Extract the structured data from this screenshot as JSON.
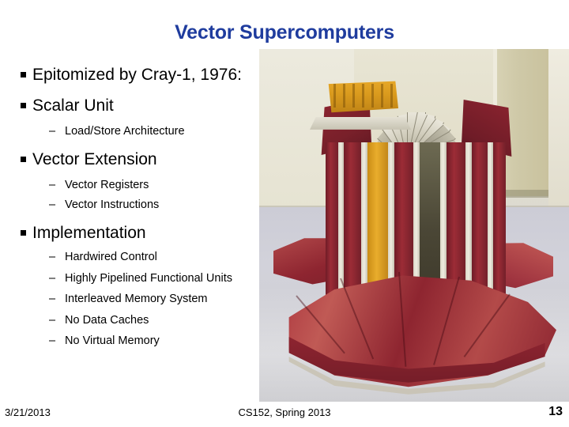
{
  "slide": {
    "title": "Vector Supercomputers",
    "title_color": "#1F3C9E",
    "bullets": [
      {
        "level": 1,
        "text": "Epitomized by Cray-1, 1976:"
      },
      {
        "level": 1,
        "text": "Scalar Unit"
      },
      {
        "level": 2,
        "text": "Load/Store Architecture"
      },
      {
        "level": 1,
        "text": "Vector Extension"
      },
      {
        "level": 2,
        "text": "Vector Registers"
      },
      {
        "level": 2,
        "text": "Vector Instructions"
      },
      {
        "level": 1,
        "text": "Implementation"
      },
      {
        "level": 2,
        "text": "Hardwired Control"
      },
      {
        "level": 2,
        "text": "Highly Pipelined Functional Units"
      },
      {
        "level": 2,
        "text": "Interleaved Memory System"
      },
      {
        "level": 2,
        "text": "No Data Caches"
      },
      {
        "level": 2,
        "text": "No Virtual Memory"
      }
    ],
    "image": {
      "caption": "Photograph of a Cray-1 supercomputer: a cylindrical cabinet with dark red and gold vertical panels, a radial fan of gray panels on top with a gold center module, standing on a red padded bench base.",
      "colors": {
        "cabinet_red": "#8d2430",
        "cabinet_gold": "#d99a1d",
        "bench_red": "#a82f3a",
        "panel_gray": "#cfcbba",
        "wall_beige": "#e3dfcb",
        "floor_gray": "#cfcfd4"
      }
    }
  },
  "footer": {
    "date": "3/21/2013",
    "course": "CS152, Spring 2013",
    "page_number": "13"
  }
}
